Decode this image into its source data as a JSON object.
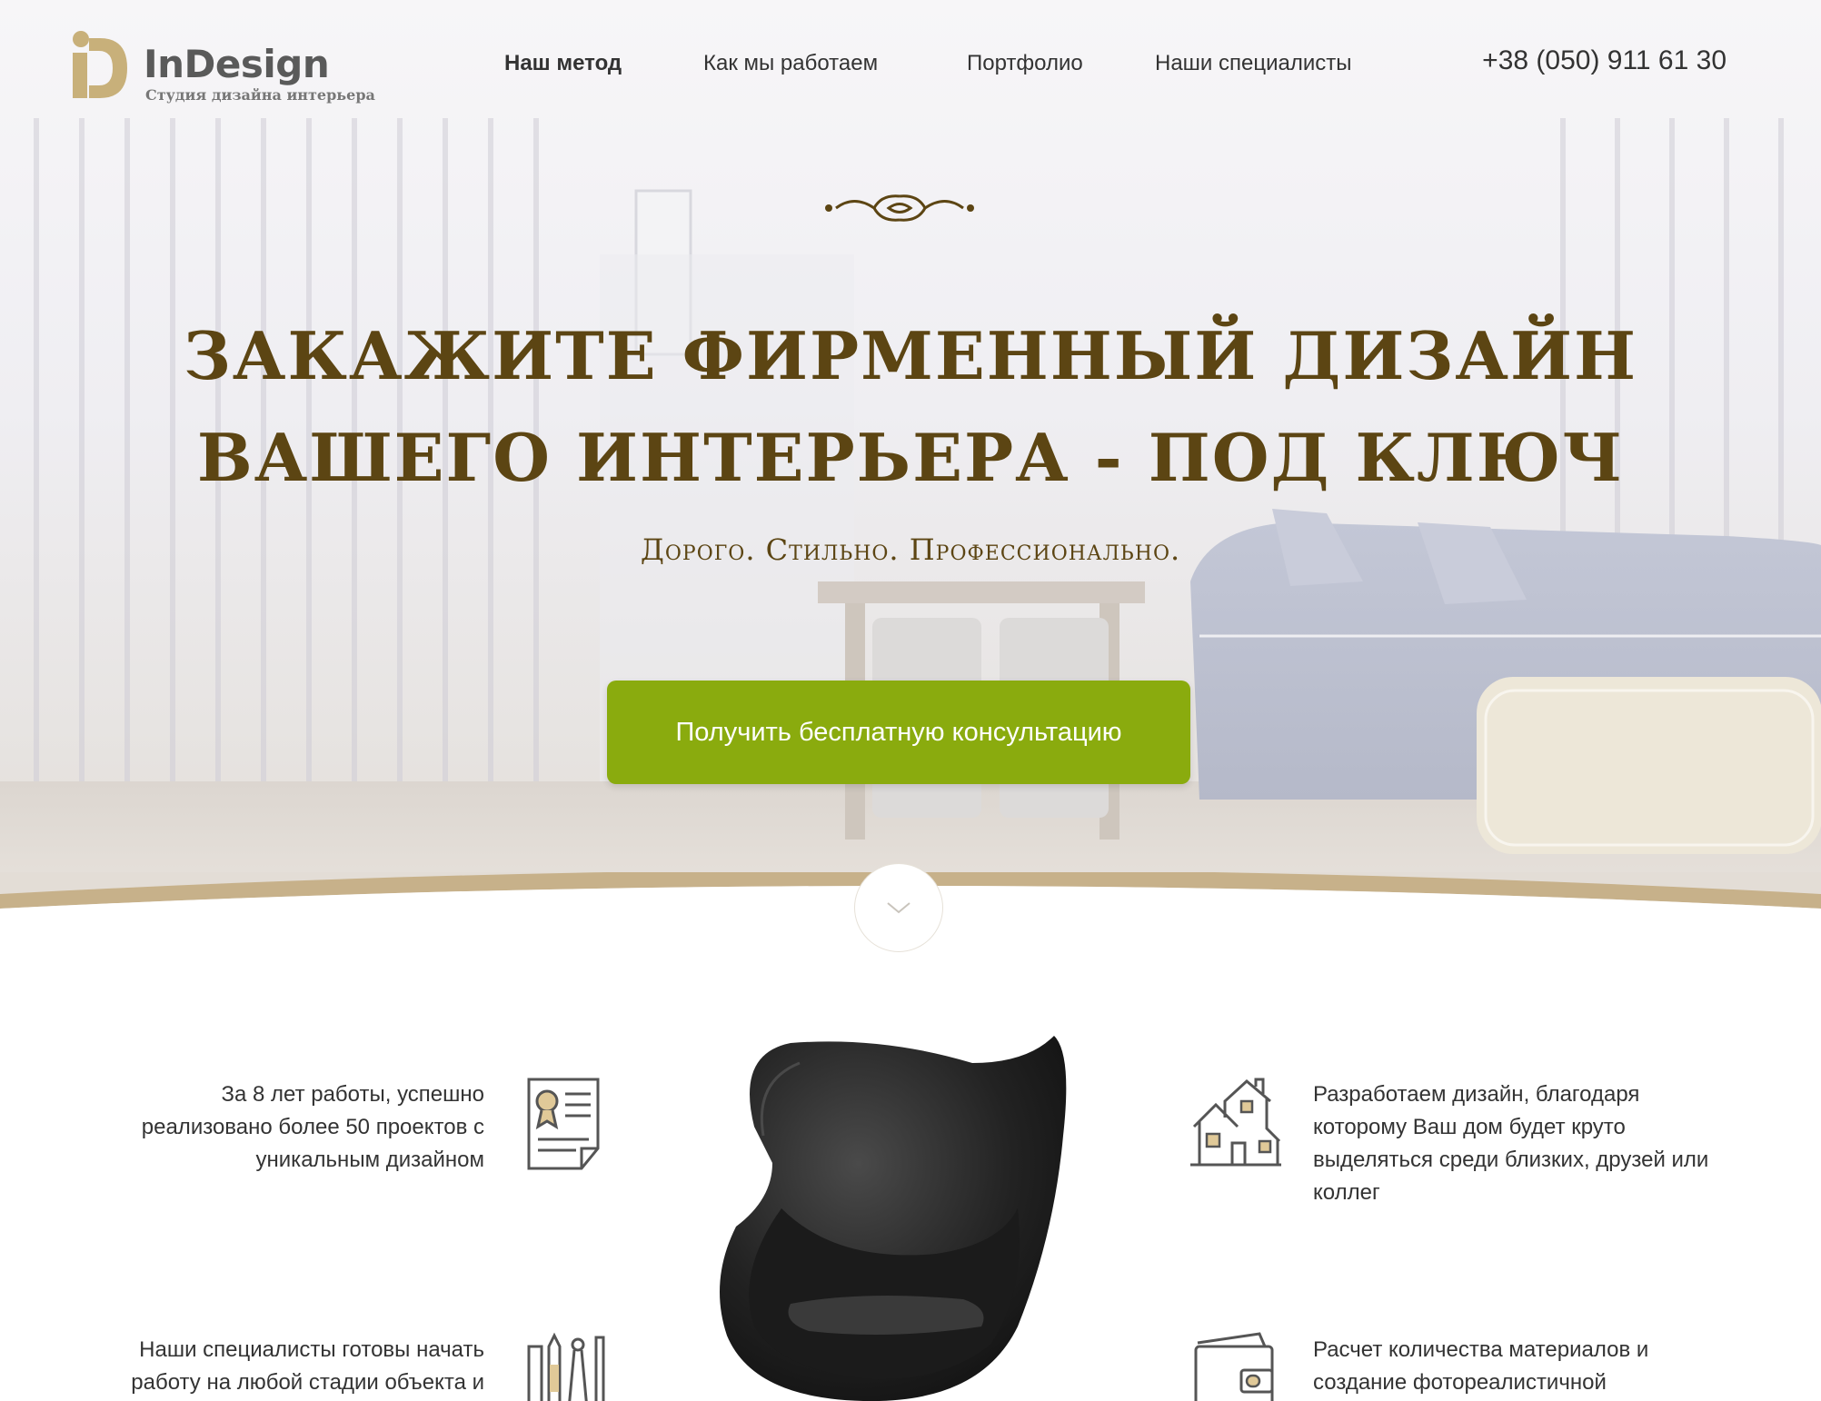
{
  "logo": {
    "name": "InDesign",
    "tagline": "Студия дизайна интерьера",
    "brand_color": "#c8b07a"
  },
  "nav": {
    "items": [
      {
        "label": "Наш метод",
        "active": true
      },
      {
        "label": "Как мы работаем",
        "active": false
      },
      {
        "label": "Портфолио",
        "active": false
      },
      {
        "label": "Наши специалисты",
        "active": false
      }
    ]
  },
  "header": {
    "phone": "+38 (050) 911 61 30"
  },
  "hero": {
    "title_line1": "ЗАКАЖИТЕ ФИРМЕННЫЙ ДИЗАЙН",
    "title_line2": "ВАШЕГО ИНТЕРЬЕРА - ПОД КЛЮЧ",
    "subtitle": "Дорого. Стильно. Профессионально.",
    "cta_label": "Получить бесплатную консультацию",
    "title_color": "#5c4513",
    "cta_color": "#8aab0e"
  },
  "features": [
    {
      "text": "За 8 лет работы, успешно реализовано более 50 проектов с уникальным дизайном",
      "icon": "certificate-icon"
    },
    {
      "text": "Разработаем дизайн, благодаря которому Ваш дом будет круто выделяться среди близких, друзей или коллег",
      "icon": "houses-icon"
    },
    {
      "text": "Наши специалисты готовы начать работу на любой стадии объекта и",
      "icon": "drawing-tools-icon"
    },
    {
      "text": "Расчет количества материалов и создание фотореалистичной",
      "icon": "wallet-icon"
    }
  ]
}
